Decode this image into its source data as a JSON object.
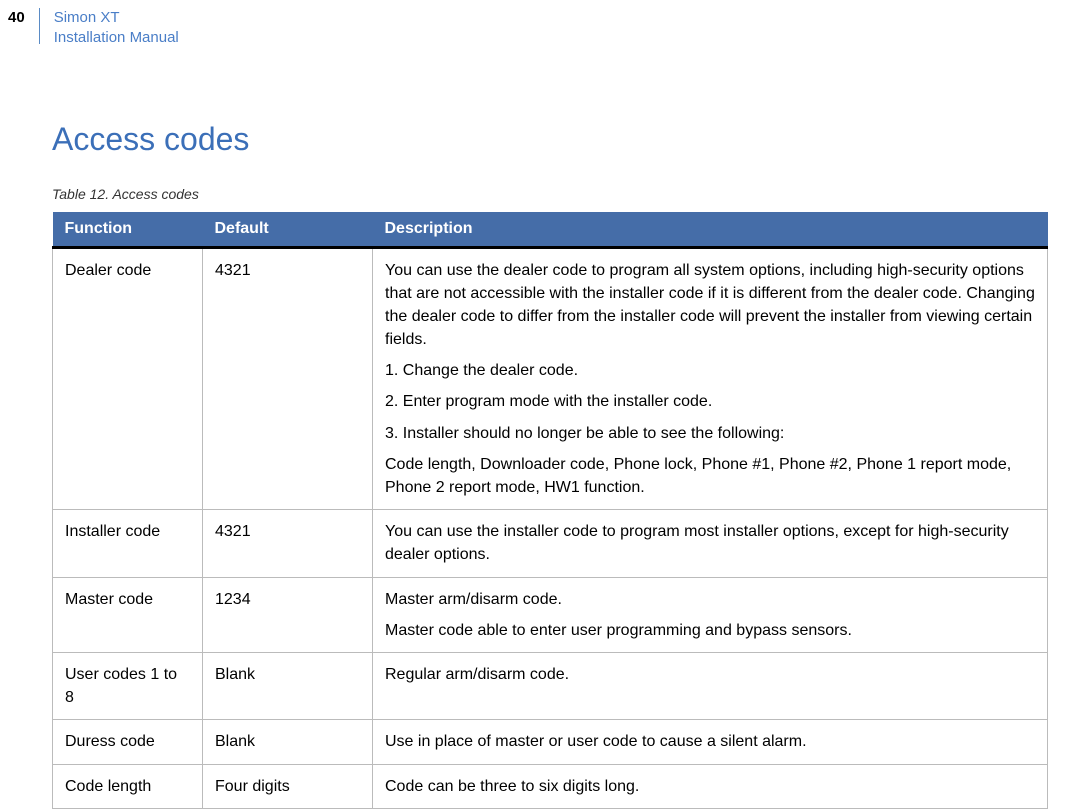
{
  "header": {
    "page_number": "40",
    "title_line1": "Simon XT",
    "title_line2": "Installation Manual"
  },
  "section": {
    "heading": "Access codes",
    "table_caption": "Table 12.   Access codes"
  },
  "table": {
    "headers": {
      "function": "Function",
      "default": "Default",
      "description": "Description"
    },
    "rows": [
      {
        "function": "Dealer code",
        "default": "4321",
        "description": [
          "You can use the dealer code to program all system options, including high-security options that are not accessible with the installer code if it is different from the dealer code.  Changing the dealer code to differ from the installer code will prevent the installer from viewing certain fields.",
          "1. Change the dealer code.",
          "2. Enter program mode with the installer code.",
          "3. Installer should no longer be able to see the following:",
          "Code length, Downloader code, Phone lock, Phone #1, Phone #2, Phone 1 report mode, Phone 2 report mode, HW1 function."
        ]
      },
      {
        "function": "Installer code",
        "default": "4321",
        "description": [
          "You can use the installer code to program most installer options, except for high-security dealer options."
        ]
      },
      {
        "function": "Master code",
        "default": "1234",
        "description": [
          "Master arm/disarm code.",
          "Master code able to enter user programming and bypass sensors."
        ]
      },
      {
        "function": "User codes 1 to 8",
        "default": "Blank",
        "description": [
          "Regular arm/disarm code."
        ]
      },
      {
        "function": "Duress code",
        "default": "Blank",
        "description": [
          "Use in place of master or user code to cause a silent alarm."
        ]
      },
      {
        "function": "Code length",
        "default": "Four digits",
        "description": [
          "Code can be three to six digits long."
        ]
      }
    ]
  }
}
